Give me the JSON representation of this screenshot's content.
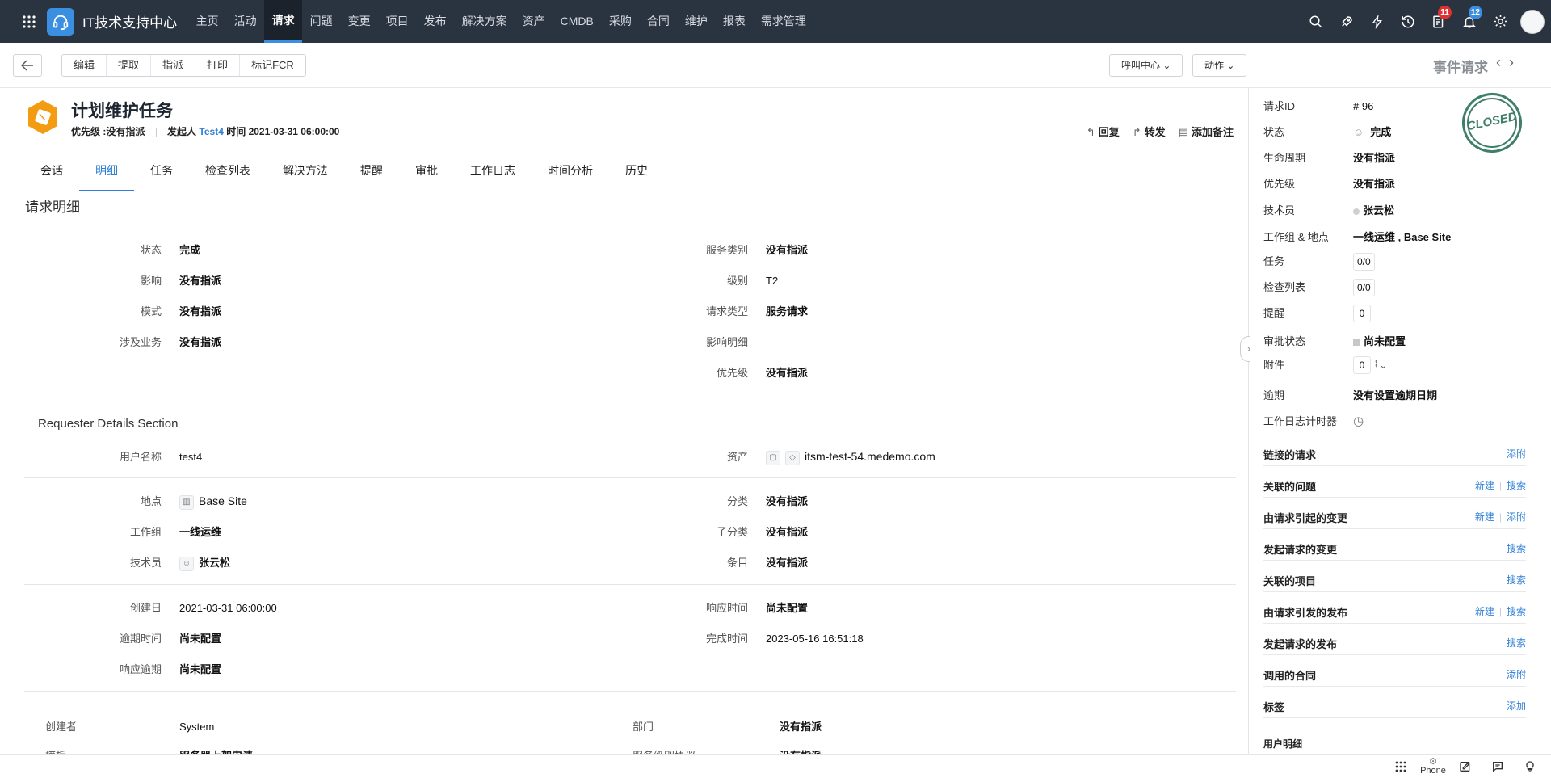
{
  "topbar": {
    "app_title": "IT技术支持中心",
    "nav": [
      "主页",
      "活动",
      "请求",
      "问题",
      "变更",
      "项目",
      "发布",
      "解决方案",
      "资产",
      "CMDB",
      "采购",
      "合同",
      "维护",
      "报表",
      "需求管理"
    ],
    "active_nav": "请求",
    "badges": {
      "tasks": "11",
      "notifications": "12"
    }
  },
  "toolbar": {
    "buttons": [
      "编辑",
      "提取",
      "指派",
      "打印",
      "标记FCR"
    ],
    "call_center": "呼叫中心",
    "actions": "动作",
    "event_title": "事件请求"
  },
  "header": {
    "title": "计划维护任务",
    "priority_label": "优先级 :",
    "priority_value": "没有指派",
    "requester_label": "发起人",
    "requester": "Test4",
    "time_label": "时间",
    "time": "2021-03-31 06:00:00",
    "actions": {
      "reply": "回复",
      "forward": "转发",
      "add_note": "添加备注"
    }
  },
  "tabs": [
    "会话",
    "明细",
    "任务",
    "检查列表",
    "解决方法",
    "提醒",
    "审批",
    "工作日志",
    "时间分析",
    "历史"
  ],
  "active_tab": "明细",
  "details": {
    "section_title": "请求明细",
    "left": [
      {
        "label": "状态",
        "value": "完成"
      },
      {
        "label": "影响",
        "value": "没有指派"
      },
      {
        "label": "模式",
        "value": "没有指派"
      },
      {
        "label": "涉及业务",
        "value": "没有指派"
      }
    ],
    "right": [
      {
        "label": "服务类别",
        "value": "没有指派"
      },
      {
        "label": "级别",
        "value": "T2"
      },
      {
        "label": "请求类型",
        "value": "服务请求"
      },
      {
        "label": "影响明细",
        "value": "-"
      },
      {
        "label": "优先级",
        "value": "没有指派"
      }
    ]
  },
  "requester": {
    "section_title": "Requester Details Section",
    "username_label": "用户名称",
    "username": "test4",
    "asset_label": "资产",
    "asset": "itsm-test-54.medemo.com",
    "site_label": "地点",
    "site": "Base Site",
    "category_label": "分类",
    "category": "没有指派",
    "group_label": "工作组",
    "group": "一线运维",
    "subcategory_label": "子分类",
    "subcategory": "没有指派",
    "technician_label": "技术员",
    "technician": "张云松",
    "item_label": "条目",
    "item": "没有指派",
    "created_label": "创建日",
    "created": "2021-03-31 06:00:00",
    "response_time_label": "响应时间",
    "response_time": "尚未配置",
    "due_label": "逾期时间",
    "due": "尚未配置",
    "completed_label": "完成时间",
    "completed": "2023-05-16 16:51:18",
    "response_due_label": "响应逾期",
    "response_due": "尚未配置",
    "creator_label": "创建者",
    "creator": "System",
    "dept_label": "部门",
    "dept": "没有指派",
    "template_label": "模板",
    "template": "服务器上架申请",
    "sla_label": "服务级别协议",
    "sla": "没有指派"
  },
  "side": {
    "stamp": "CLOSED",
    "rows": [
      {
        "label": "请求ID",
        "value": "# 96"
      },
      {
        "label": "状态",
        "value": "完成"
      },
      {
        "label": "生命周期",
        "value": "没有指派"
      },
      {
        "label": "优先级",
        "value": "没有指派"
      },
      {
        "label": "技术员",
        "value": "张云松"
      },
      {
        "label": "工作组 & 地点",
        "value": "一线运维 , Base Site"
      },
      {
        "label": "任务",
        "value": "0/0"
      },
      {
        "label": "检查列表",
        "value": "0/0"
      },
      {
        "label": "提醒",
        "value": "0"
      },
      {
        "label": "审批状态",
        "value": "尚未配置"
      },
      {
        "label": "附件",
        "value": "0"
      },
      {
        "label": "逾期",
        "value": "没有设置逾期日期"
      },
      {
        "label": "工作日志计时器",
        "value": ""
      }
    ],
    "links": [
      {
        "label": "链接的请求",
        "actions": [
          "添附"
        ]
      },
      {
        "label": "关联的问题",
        "actions": [
          "新建",
          "搜索"
        ]
      },
      {
        "label": "由请求引起的变更",
        "actions": [
          "新建",
          "添附"
        ]
      },
      {
        "label": "发起请求的变更",
        "actions": [
          "搜索"
        ]
      },
      {
        "label": "关联的项目",
        "actions": [
          "搜索"
        ]
      },
      {
        "label": "由请求引发的发布",
        "actions": [
          "新建",
          "搜索"
        ]
      },
      {
        "label": "发起请求的发布",
        "actions": [
          "搜索"
        ]
      },
      {
        "label": "调用的合同",
        "actions": [
          "添附"
        ]
      },
      {
        "label": "标签",
        "actions": [
          "添加"
        ]
      }
    ],
    "user_details": "用户明细"
  },
  "bottombar": {
    "phone": "Phone"
  },
  "colors": {
    "topbar": "#2a3340",
    "accent": "#2f7fd6",
    "stamp": "#3f7f6a",
    "icon_orange": "#f39c12"
  }
}
